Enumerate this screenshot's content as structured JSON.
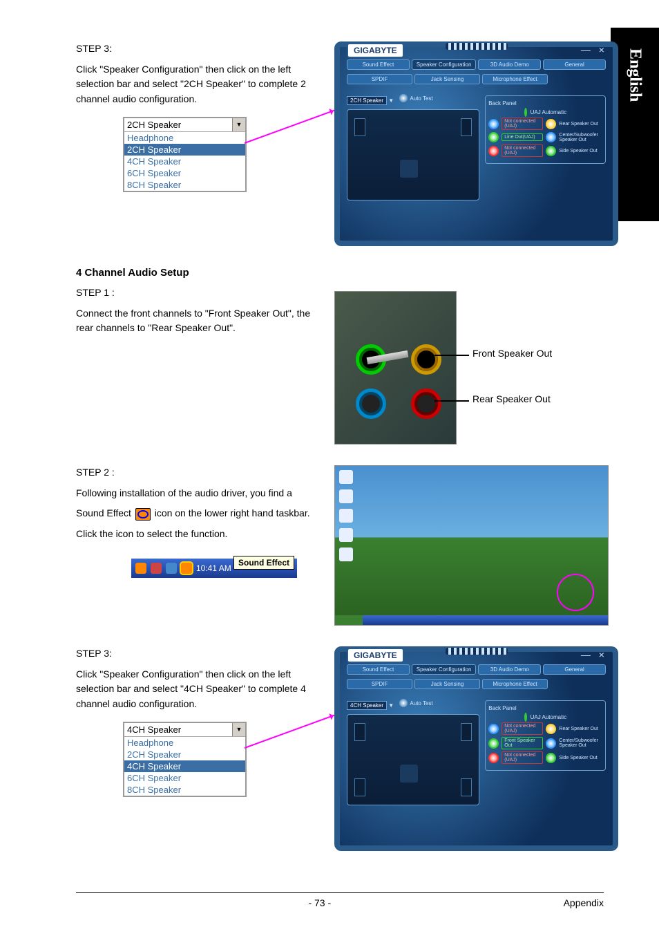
{
  "sideTab": "English",
  "section1": {
    "stepTitle": "STEP 3:",
    "stepBody": "Click \"Speaker Configuration\" then click on the left selection bar and select \"2CH Speaker\" to complete 2 channel audio configuration.",
    "dropdown": {
      "selected": "2CH Speaker",
      "options": [
        "Headphone",
        "2CH Speaker",
        "4CH Speaker",
        "6CH Speaker",
        "8CH Speaker"
      ],
      "highlightIndex": 1
    },
    "app": {
      "brand": "GIGABYTE",
      "closeGlyphs": "— ×",
      "tabs": [
        "Sound Effect",
        "Speaker Configuration",
        "3D Audio Demo",
        "General",
        "SPDIF",
        "Jack Sensing",
        "Microphone Effect"
      ],
      "activeTabIndex": 1,
      "speakerSel": "2CH Speaker",
      "autoTest": "Auto Test",
      "backPanel": "Back Panel",
      "uaj": "UAJ Automatic",
      "jacks": [
        {
          "ring": "blue",
          "box": "Not connected (UAJ)",
          "side": "yel",
          "label": "Rear Speaker Out"
        },
        {
          "ring": "green",
          "box": "Line Out(UAJ)",
          "boxClass": "g",
          "side": "blue",
          "label": "Center/Subwoofer Speaker Out"
        },
        {
          "ring": "red",
          "box": "Not connected (UAJ)",
          "side": "green",
          "label": "Side Speaker Out"
        }
      ]
    }
  },
  "heading4ch": "4 Channel Audio Setup",
  "section2": {
    "stepTitle": "STEP 1 :",
    "stepBody": "Connect the front channels to \"Front Speaker Out\", the rear channels to \"Rear Speaker Out\".",
    "callout1": "Front Speaker Out",
    "callout2": "Rear Speaker Out"
  },
  "section3": {
    "stepTitle": "STEP 2 :",
    "body1": "Following installation of the audio driver, you find a",
    "body2a": "Sound Effect",
    "body2b": "icon on the lower right hand taskbar.",
    "body3": "Click the icon to select the function.",
    "tooltip": "Sound Effect",
    "clock": "10:41 AM"
  },
  "section4": {
    "stepTitle": "STEP 3:",
    "stepBody": "Click \"Speaker Configuration\" then click on the left selection bar and select \"4CH Speaker\" to complete 4 channel audio configuration.",
    "dropdown": {
      "selected": "4CH Speaker",
      "options": [
        "Headphone",
        "2CH Speaker",
        "4CH Speaker",
        "6CH Speaker",
        "8CH Speaker"
      ],
      "highlightIndex": 2
    },
    "app": {
      "brand": "GIGABYTE",
      "closeGlyphs": "— ×",
      "tabs": [
        "Sound Effect",
        "Speaker Configuration",
        "3D Audio Demo",
        "General",
        "SPDIF",
        "Jack Sensing",
        "Microphone Effect"
      ],
      "activeTabIndex": 1,
      "speakerSel": "4CH Speaker",
      "autoTest": "Auto Test",
      "backPanel": "Back Panel",
      "uaj": "UAJ Automatic",
      "jacks": [
        {
          "ring": "blue",
          "box": "Not connected (UAJ)",
          "side": "yel",
          "label": "Rear Speaker Out"
        },
        {
          "ring": "green",
          "box": "Front Speaker Out",
          "boxClass": "g",
          "side": "blue",
          "label": "Center/Subwoofer Speaker Out"
        },
        {
          "ring": "red",
          "box": "Not connected (UAJ)",
          "side": "green",
          "label": "Side Speaker Out"
        }
      ]
    }
  },
  "footer": {
    "page": "- 73 -",
    "section": "Appendix"
  }
}
